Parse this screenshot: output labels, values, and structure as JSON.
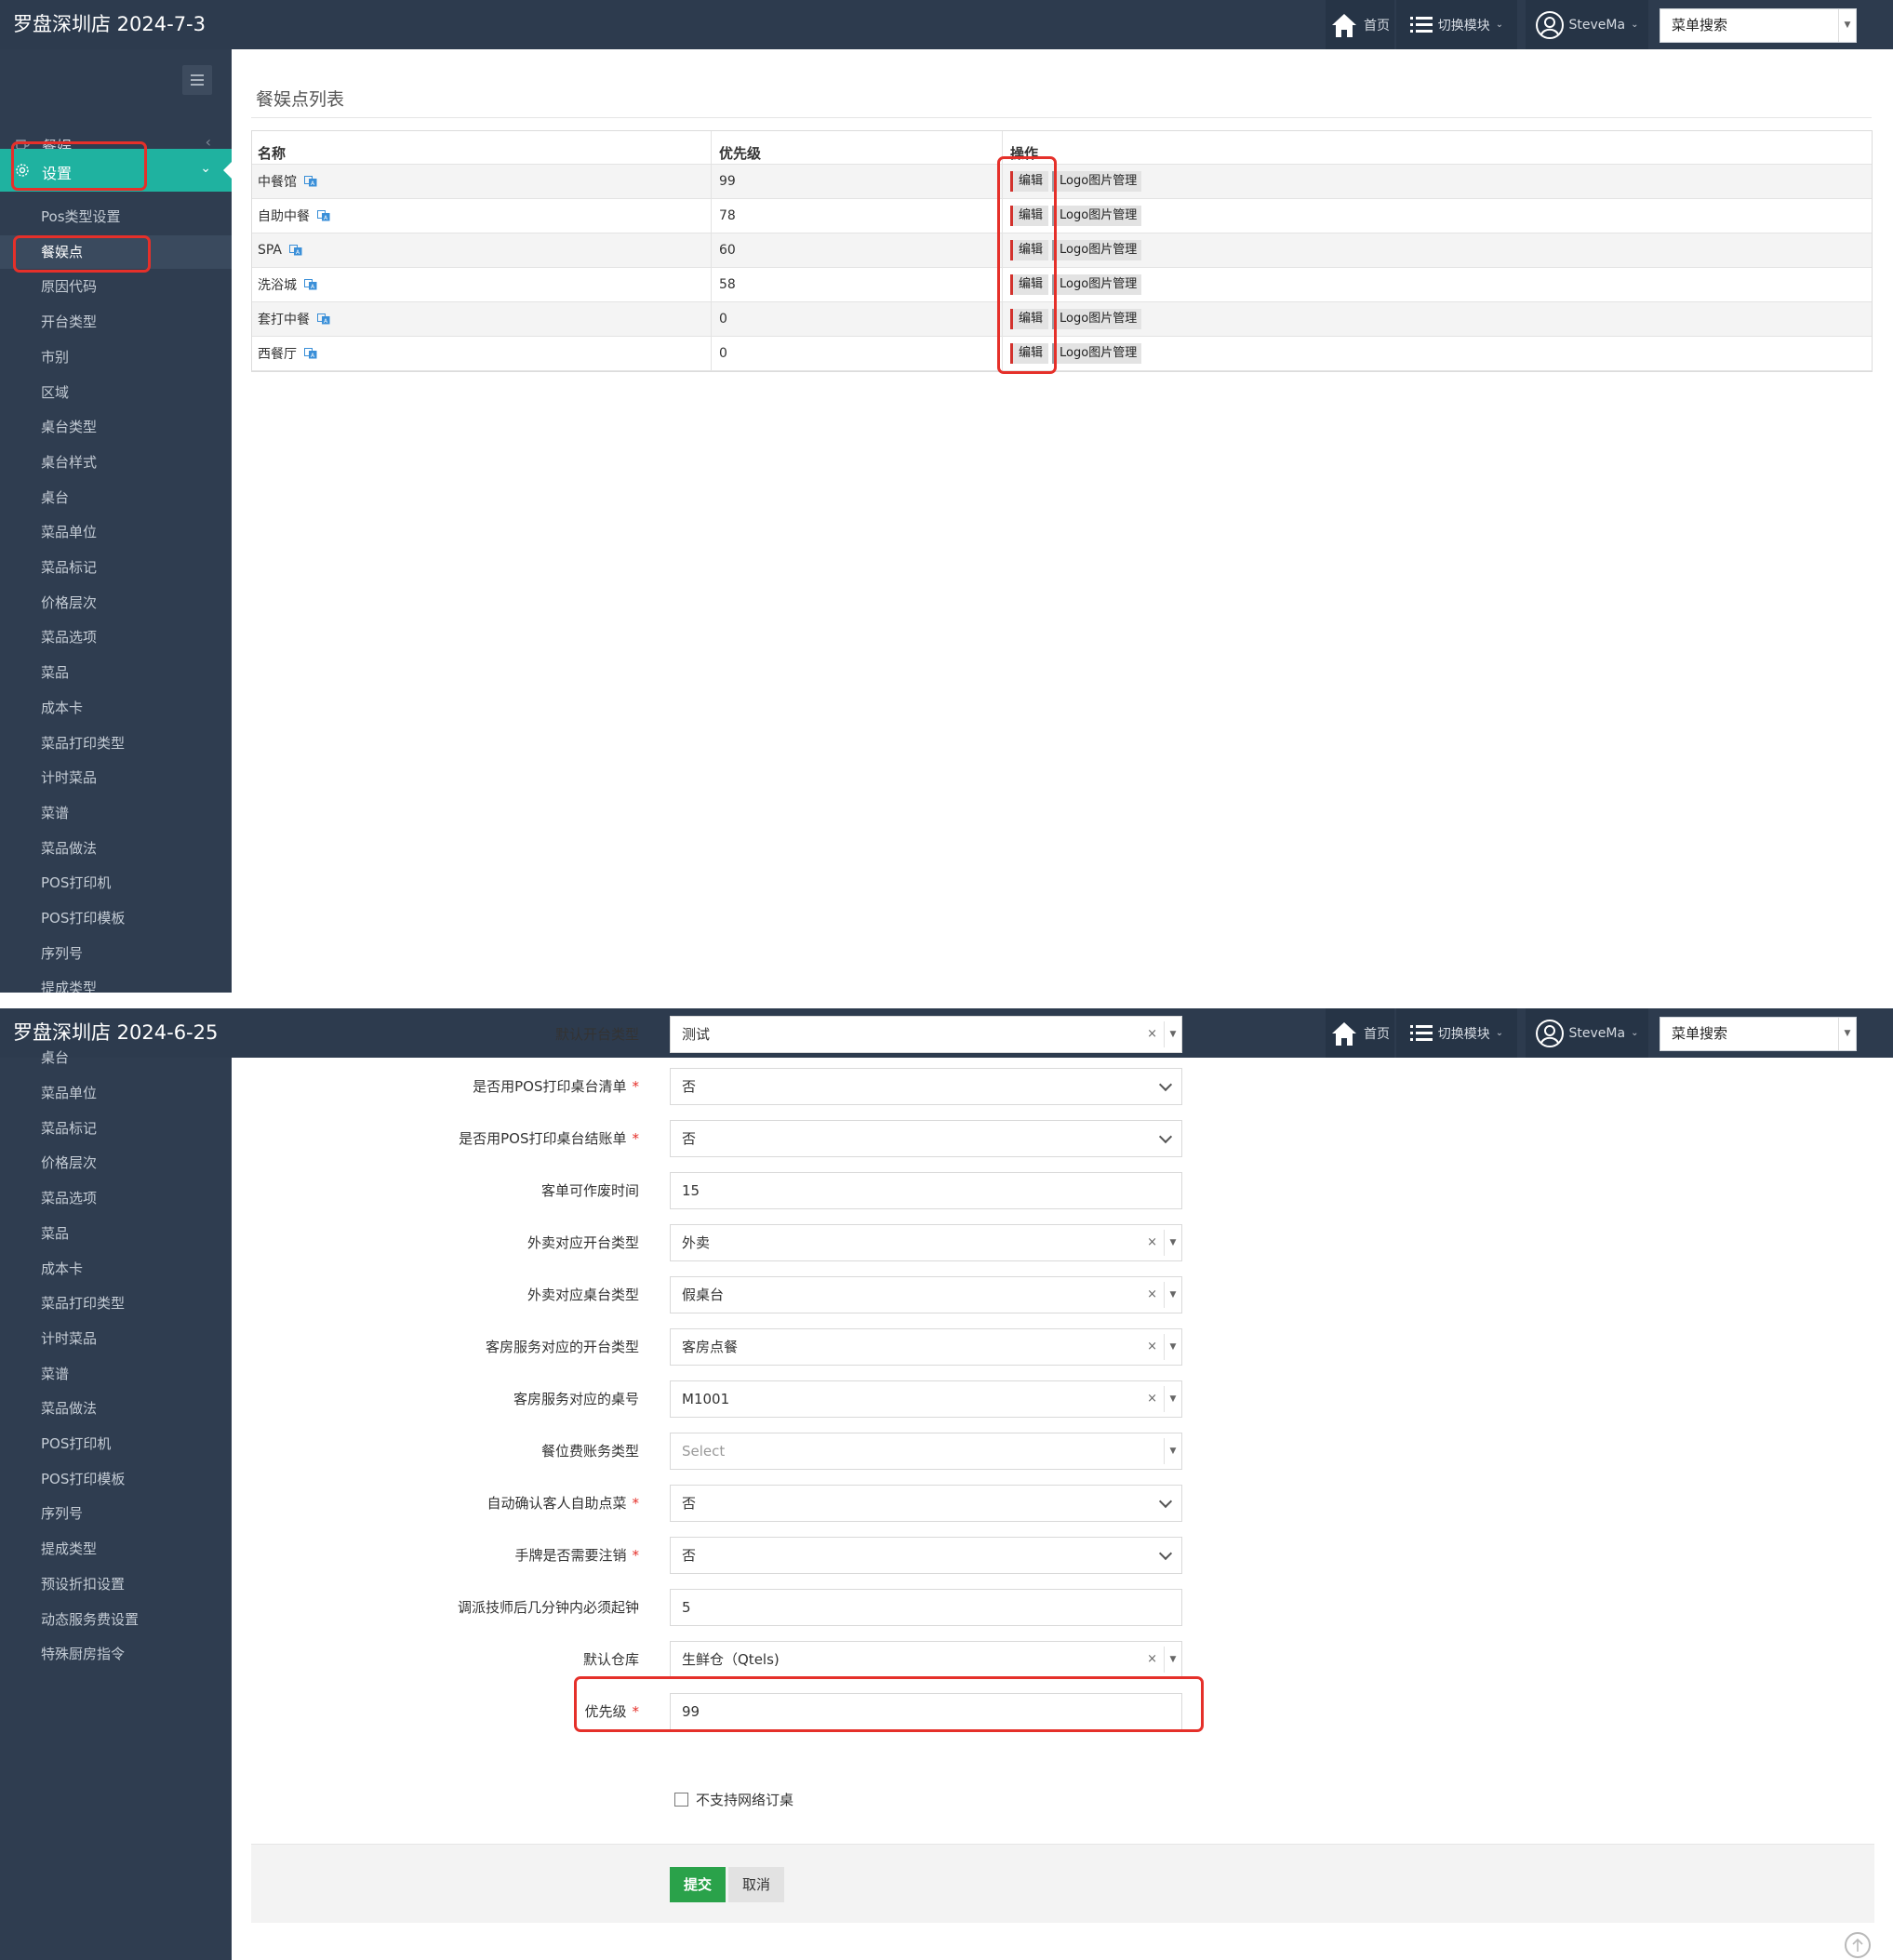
{
  "common": {
    "nav_home": "首页",
    "nav_switch": "切换模块",
    "nav_user": "SteveMa",
    "menu_search": "菜单搜索"
  },
  "screen1": {
    "brand": "罗盘深圳店 2024-7-3",
    "sidebar": {
      "section_dining": "餐娱",
      "section_settings": "设置",
      "items": [
        "Pos类型设置",
        "餐娱点",
        "原因代码",
        "开台类型",
        "市别",
        "区域",
        "桌台类型",
        "桌台样式",
        "桌台",
        "菜品单位",
        "菜品标记",
        "价格层次",
        "菜品选项",
        "菜品",
        "成本卡",
        "菜品打印类型",
        "计时菜品",
        "菜谱",
        "菜品做法",
        "POS打印机",
        "POS打印模板",
        "序列号",
        "提成类型"
      ],
      "active_item": "餐娱点"
    },
    "page_title": "餐娱点列表",
    "table": {
      "headers": [
        "名称",
        "优先级",
        "操作"
      ],
      "rows": [
        {
          "name": "中餐馆",
          "priority": "99"
        },
        {
          "name": "自助中餐",
          "priority": "78"
        },
        {
          "name": "SPA",
          "priority": "60"
        },
        {
          "name": "洗浴城",
          "priority": "58"
        },
        {
          "name": "套打中餐",
          "priority": "0"
        },
        {
          "name": "西餐厅",
          "priority": "0"
        }
      ],
      "edit_label": "编辑",
      "logo_label": "Logo图片管理"
    }
  },
  "screen2": {
    "brand": "罗盘深圳店 2024-6-25",
    "sidebar": {
      "cut_top_item": "桌台",
      "items": [
        "菜品单位",
        "菜品标记",
        "价格层次",
        "菜品选项",
        "菜品",
        "成本卡",
        "菜品打印类型",
        "计时菜品",
        "菜谱",
        "菜品做法",
        "POS打印机",
        "POS打印模板",
        "序列号",
        "提成类型",
        "预设折扣设置",
        "动态服务费设置",
        "特殊厨房指令"
      ]
    },
    "form": {
      "fields": [
        {
          "label": "默认开台类型",
          "value": "测试",
          "required": false,
          "kind": "select2"
        },
        {
          "label": "是否用POS打印桌台清单",
          "value": "否",
          "required": true,
          "kind": "select"
        },
        {
          "label": "是否用POS打印桌台结账单",
          "value": "否",
          "required": true,
          "kind": "select"
        },
        {
          "label": "客单可作废时间",
          "value": "15",
          "required": false,
          "kind": "text"
        },
        {
          "label": "外卖对应开台类型",
          "value": "外卖",
          "required": false,
          "kind": "select2"
        },
        {
          "label": "外卖对应桌台类型",
          "value": "假桌台",
          "required": false,
          "kind": "select2"
        },
        {
          "label": "客房服务对应的开台类型",
          "value": "客房点餐",
          "required": false,
          "kind": "select2"
        },
        {
          "label": "客房服务对应的桌号",
          "value": "M1001",
          "required": false,
          "kind": "select2"
        },
        {
          "label": "餐位费账务类型",
          "value": "",
          "placeholder": "Select",
          "required": false,
          "kind": "select2-empty"
        },
        {
          "label": "自动确认客人自助点菜",
          "value": "否",
          "required": true,
          "kind": "select"
        },
        {
          "label": "手牌是否需要注销",
          "value": "否",
          "required": true,
          "kind": "select"
        },
        {
          "label": "调派技师后几分钟内必须起钟",
          "value": "5",
          "required": false,
          "kind": "text"
        },
        {
          "label": "默认仓库",
          "value": "生鲜仓（Qtels)",
          "required": false,
          "kind": "select2"
        },
        {
          "label": "优先级",
          "value": "99",
          "required": true,
          "kind": "text"
        }
      ],
      "checkbox_label": "不支持网络订桌",
      "submit_label": "提交",
      "cancel_label": "取消"
    }
  }
}
